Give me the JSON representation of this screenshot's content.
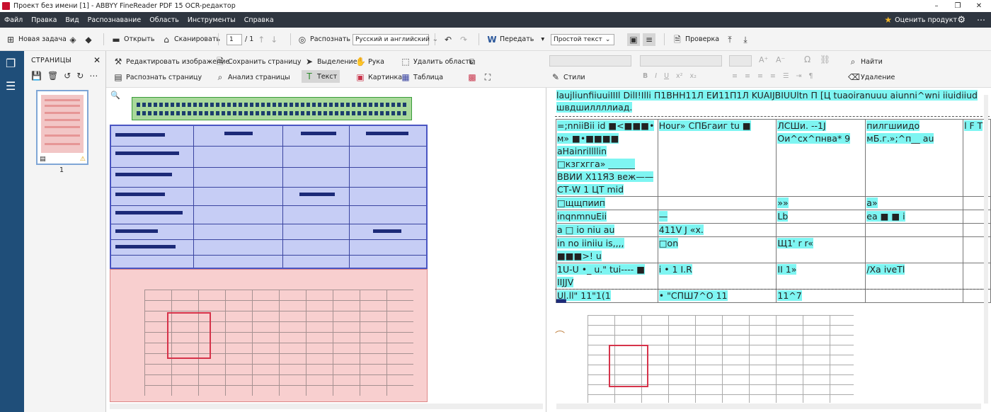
{
  "window": {
    "title": "Проект без имени [1] - ABBYY FineReader PDF 15 OCR-редактор",
    "controls": [
      "–",
      "❐",
      "✕"
    ]
  },
  "menu": {
    "items": [
      "Файл",
      "Правка",
      "Вид",
      "Распознавание",
      "Область",
      "Инструменты",
      "Справка"
    ],
    "rate_label": "Оценить продукт"
  },
  "toolbar": {
    "new_task": "Новая задача",
    "open": "Открыть",
    "scan": "Сканировать",
    "page_current": "1",
    "page_total": "/ 1",
    "recognize": "Распознать",
    "language": "Русский и английский",
    "send": "Передать",
    "text_style": "Простой текст",
    "verify": "Проверка"
  },
  "pages_panel": {
    "header": "СТРАНИЦЫ",
    "page_number": "1"
  },
  "image_tools": {
    "edit_image": "Редактировать изображение",
    "recognize_page": "Распознать страницу",
    "save_page": "Сохранить страницу",
    "analyze_page": "Анализ страницы",
    "selection": "Выделение",
    "text": "Текст",
    "hand": "Рука",
    "picture": "Картинка",
    "delete_area": "Удалить область",
    "table": "Таблица"
  },
  "text_tools": {
    "styles": "Стили",
    "find": "Найти",
    "delete": "Удаление"
  },
  "ocr_text": {
    "heading": "laujliunfiiuuiIIIl DilI!Illi П1ВНН11Л ЕИ11П1Л KUAIJBIUUltn П [Ц tuaoiranuuu aiunni^wni iiuidiiud швдшиллллиад.",
    "rows": [
      [
        "=;nniiBii id ■<■■■• м» ■•■■■■ aHainrillllin □кзгхгга» ______ ВВИИ Х11ЯЗ веж—— СТ-W 1 ЦТ mid",
        "Hour» СПБгаиг tu ■",
        "ЛСШи. --1J Ои^сх^пнва* 9",
        "пилгшиидо мБ.г.»;^п__ au",
        "l F T"
      ],
      [
        "□щщпиип",
        "",
        "»»",
        "a»",
        ""
      ],
      [
        "inqnmnuEii",
        "—",
        "Lb",
        "ea ■ ■ i",
        ""
      ],
      [
        "a □ io niu au",
        "411V J «x.",
        "",
        "",
        ""
      ],
      [
        "in no iiniiu is,,,, ■■■>! u",
        "□on",
        "Щ1' r r«",
        "",
        ""
      ],
      [
        "1U-U •_ u.\" tui---- ■ IIJJV",
        "i • 1 I.R",
        "II 1»",
        "/Xa iveTl",
        ""
      ],
      [
        "Ul.ll\" 11\"1(1",
        "• \"СПШ7^О 11",
        "11^7",
        "",
        ""
      ]
    ]
  },
  "colors": {
    "menubar": "#2f3640",
    "rail": "#1f4e79",
    "text_area": "#a9d99b",
    "table_area": "#c6cdf5",
    "picture_area": "#f8cfcf",
    "ocr_highlight": "#7ef5f2"
  }
}
